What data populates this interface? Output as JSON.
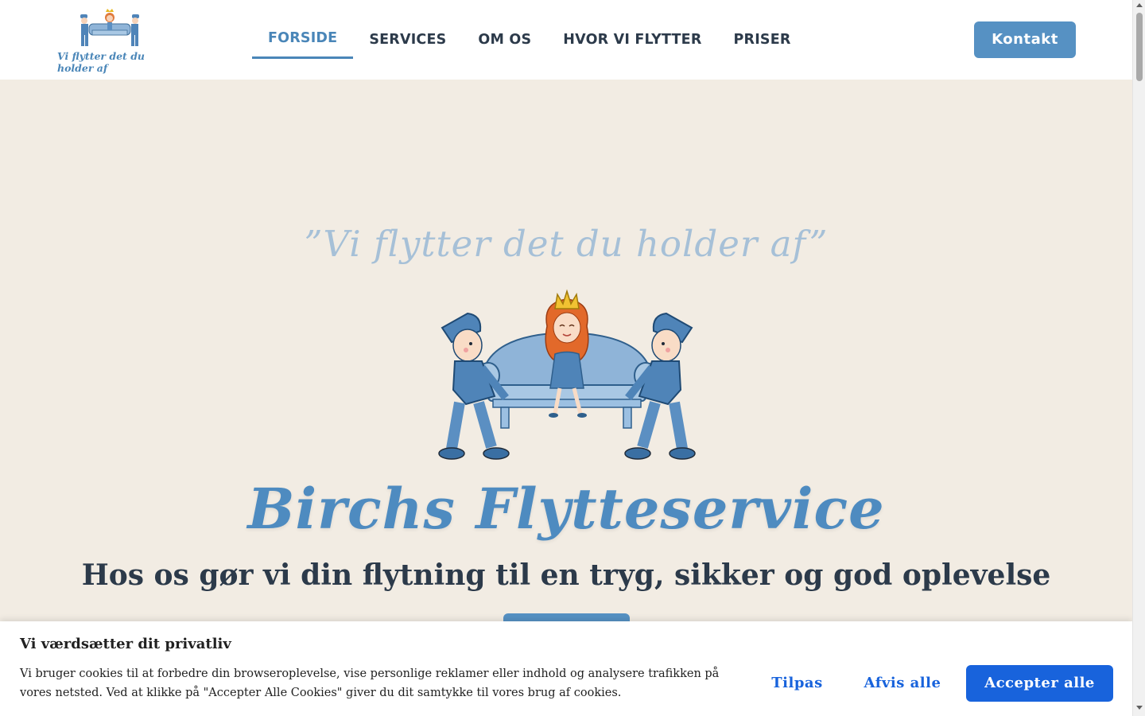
{
  "header": {
    "logo_text": "Vi flytter det du holder af",
    "nav": [
      {
        "label": "FORSIDE",
        "active": true
      },
      {
        "label": "SERVICES",
        "active": false
      },
      {
        "label": "OM OS",
        "active": false
      },
      {
        "label": "HVOR VI FLYTTER",
        "active": false
      },
      {
        "label": "PRISER",
        "active": false
      }
    ],
    "contact_label": "Kontakt"
  },
  "hero": {
    "tagline": "”Vi flytter det du holder af”",
    "title": "Birchs Flytteservice",
    "subtitle": "Hos os gør vi din flytning til en tryg, sikker og god oplevelse",
    "illustration_icon": "movers-carrying-sofa-queen-illustration"
  },
  "cookie_banner": {
    "title": "Vi værdsætter dit privatliv",
    "text": "Vi bruger cookies til at forbedre din browseroplevelse, vise personlige reklamer eller indhold og analysere trafikken på vores netsted. Ved at klikke på \"Accepter Alle Cookies\" giver du dit samtykke til vores brug af cookies.",
    "customize_label": "Tilpas",
    "reject_label": "Afvis alle",
    "accept_label": "Accepter alle"
  },
  "colors": {
    "brand_blue": "#4e8bc0",
    "button_blue": "#5691c3",
    "cookie_blue": "#1863dc",
    "hero_bg": "#f2ece3",
    "text_dark": "#2c3a4a"
  }
}
